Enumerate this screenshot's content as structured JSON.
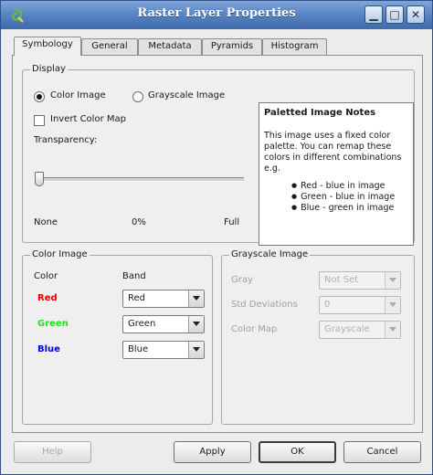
{
  "window": {
    "title": "Raster Layer Properties",
    "minimize_glyph": "▁",
    "maximize_glyph": "□",
    "close_glyph": "✕",
    "accent": "#4a76b8"
  },
  "tabs": [
    {
      "label": "Symbology",
      "active": true
    },
    {
      "label": "General",
      "active": false
    },
    {
      "label": "Metadata",
      "active": false
    },
    {
      "label": "Pyramids",
      "active": false
    },
    {
      "label": "Histogram",
      "active": false
    }
  ],
  "display": {
    "title": "Display",
    "color_image_label": "Color Image",
    "color_image_selected": true,
    "grayscale_image_label": "Grayscale Image",
    "grayscale_image_selected": false,
    "invert_label": "Invert Color Map",
    "invert_checked": false,
    "transparency_label": "Transparency:",
    "transparency_value_fraction": 0.0,
    "none_label": "None",
    "value_label": "0%",
    "full_label": "Full"
  },
  "notes": {
    "title": "Paletted Image Notes",
    "body": "This image uses a fixed color palette. You can remap these colors in different combinations e.g.",
    "items": [
      "Red - blue in image",
      "Green - blue in image",
      "Blue - green in image"
    ]
  },
  "color_image": {
    "title": "Color Image",
    "col_color": "Color",
    "col_band": "Band",
    "rows": [
      {
        "label": "Red",
        "color": "#e00000",
        "value": "Red"
      },
      {
        "label": "Green",
        "color": "#22dd22",
        "value": "Green"
      },
      {
        "label": "Blue",
        "color": "#0000cc",
        "value": "Blue"
      }
    ]
  },
  "grayscale_image": {
    "title": "Grayscale Image",
    "gray_label": "Gray",
    "gray_value": "Not Set",
    "std_label": "Std Deviations",
    "std_value": "0",
    "colormap_label": "Color Map",
    "colormap_value": "Grayscale"
  },
  "buttons": {
    "help": "Help",
    "apply": "Apply",
    "ok": "OK",
    "cancel": "Cancel"
  }
}
